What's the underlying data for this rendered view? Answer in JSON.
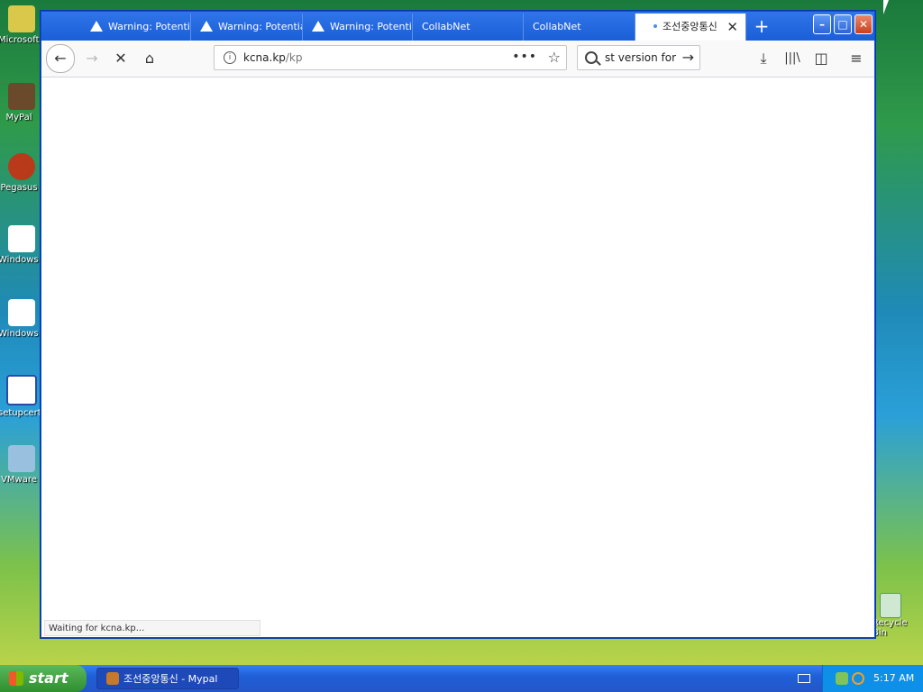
{
  "desktop": {
    "icons": [
      {
        "label": "Microsoft Outlook",
        "name": "outlook-desktop-icon"
      },
      {
        "label": "MyPal",
        "name": "mypal-desktop-icon"
      },
      {
        "label": "Pegasus",
        "name": "pegasus-desktop-icon"
      },
      {
        "label": "Windows Ultimate",
        "name": "windows-ultimate-desktop-icon-1"
      },
      {
        "label": "Windows Ultimate",
        "name": "windows-ultimate-desktop-icon-2"
      },
      {
        "label": "setupcert",
        "name": "setupcert-desktop-icon"
      },
      {
        "label": "VMware",
        "name": "vmware-desktop-icon"
      }
    ],
    "recycle_bin_label": "Recycle Bin"
  },
  "browser": {
    "tabs": [
      {
        "label": "Warning: Potential Security Risk Ahead",
        "icon": "warning-icon"
      },
      {
        "label": "Warning: Potential Security Risk Ahead",
        "icon": "warning-icon"
      },
      {
        "label": "Warning: Potential Security Risk Ahead",
        "icon": "warning-icon"
      },
      {
        "label": "CollabNet",
        "icon": ""
      },
      {
        "label": "CollabNet",
        "icon": ""
      },
      {
        "label": "조선중앙통신",
        "icon": "loading-dot-icon",
        "active": true
      }
    ],
    "new_tab_label": "+",
    "url": {
      "host": "kcna.kp",
      "path": "/kp"
    },
    "search_text": "st version for",
    "status_text": "Waiting for kcna.kp..."
  },
  "taskbar": {
    "start_label": "start",
    "window_button_label": "조선중앙통신 - Mypal",
    "clock": "5:17 AM"
  },
  "colors": {
    "titlebar": "#1b5fd8",
    "taskbar": "#2456c8",
    "start": "#2f8f2f"
  }
}
